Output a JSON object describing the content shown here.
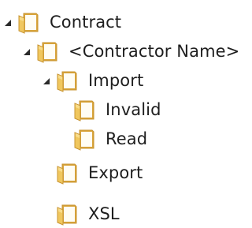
{
  "tree": {
    "items": [
      {
        "label": "Contract",
        "expanded": true,
        "level": 0
      },
      {
        "label": "<Contractor Name>",
        "expanded": true,
        "level": 1
      },
      {
        "label": "Import",
        "expanded": true,
        "level": 2
      },
      {
        "label": "Invalid",
        "expanded": false,
        "level": 3
      },
      {
        "label": "Read",
        "expanded": false,
        "level": 3
      },
      {
        "label": "Export",
        "expanded": false,
        "level": 2
      },
      {
        "label": "XSL",
        "expanded": false,
        "level": 2
      }
    ]
  },
  "icons": {
    "expander": "expanded-triangle-icon",
    "folder": "folder-icon"
  },
  "colors": {
    "folder_front": "#f0c75e",
    "folder_back": "#d9a53b",
    "folder_paper": "#fffdf4",
    "folder_outline": "#c89432",
    "text": "#1e1e1e",
    "expander": "#2b2b2b"
  }
}
